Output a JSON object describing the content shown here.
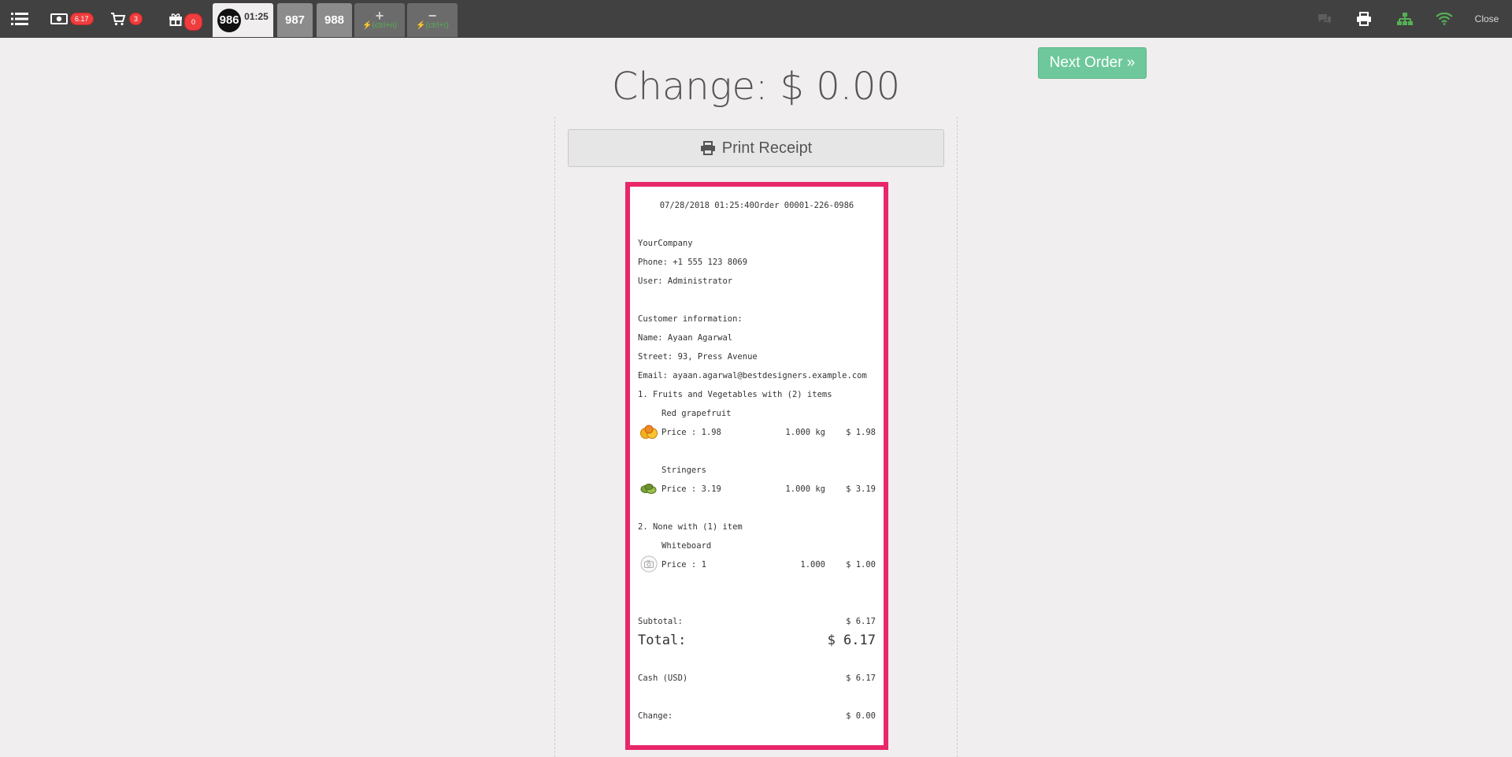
{
  "topbar": {
    "cash_badge": "6.17",
    "cart_badge": "3",
    "gift_badge": "0",
    "current_order": {
      "number": "986",
      "time": "01:25"
    },
    "other_orders": [
      "987",
      "988"
    ],
    "new_order_shortcut": "(ctrl+n)",
    "remove_order_shortcut": "(ctrl+r)",
    "close_label": "Close",
    "colors": {
      "bar": "#414141",
      "badge": "#ef3d3d",
      "network_ok": "#54b054"
    }
  },
  "main": {
    "change_title": "Change: $ 0.00",
    "next_order_label": "Next Order »",
    "print_receipt_label": "Print Receipt"
  },
  "receipt": {
    "header": "07/28/2018 01:25:40Order 00001-226-0986",
    "company": "YourCompany",
    "phone": "Phone: +1 555 123 8069",
    "user": "User: Administrator",
    "customer_heading": "Customer information:",
    "customer_name": "Name: Ayaan Agarwal",
    "customer_street": "Street: 93, Press Avenue",
    "customer_email": "Email: ayaan.agarwal@bestdesigners.example.com",
    "groups": [
      {
        "title": "1. Fruits and Vegetables with (2) items",
        "lines": [
          {
            "product": "Red grapefruit",
            "price": "Price : 1.98",
            "qty": "1.000 kg",
            "amount": "$ 1.98",
            "image": "grapefruit-image"
          },
          {
            "product": "Stringers",
            "price": "Price : 3.19",
            "qty": "1.000 kg",
            "amount": "$ 3.19",
            "image": "stringers-image"
          }
        ]
      },
      {
        "title": "2. None with (1) item",
        "lines": [
          {
            "product": "Whiteboard",
            "price": "Price : 1",
            "qty": "1.000",
            "amount": "$ 1.00",
            "image": "placeholder-camera-image"
          }
        ]
      }
    ],
    "subtotal_label": "Subtotal:",
    "subtotal_value": "$ 6.17",
    "total_label": "Total:",
    "total_value": "$ 6.17",
    "cash_label": "Cash (USD)",
    "cash_value": "$ 6.17",
    "change_label": "Change:",
    "change_value": "$ 0.00"
  }
}
